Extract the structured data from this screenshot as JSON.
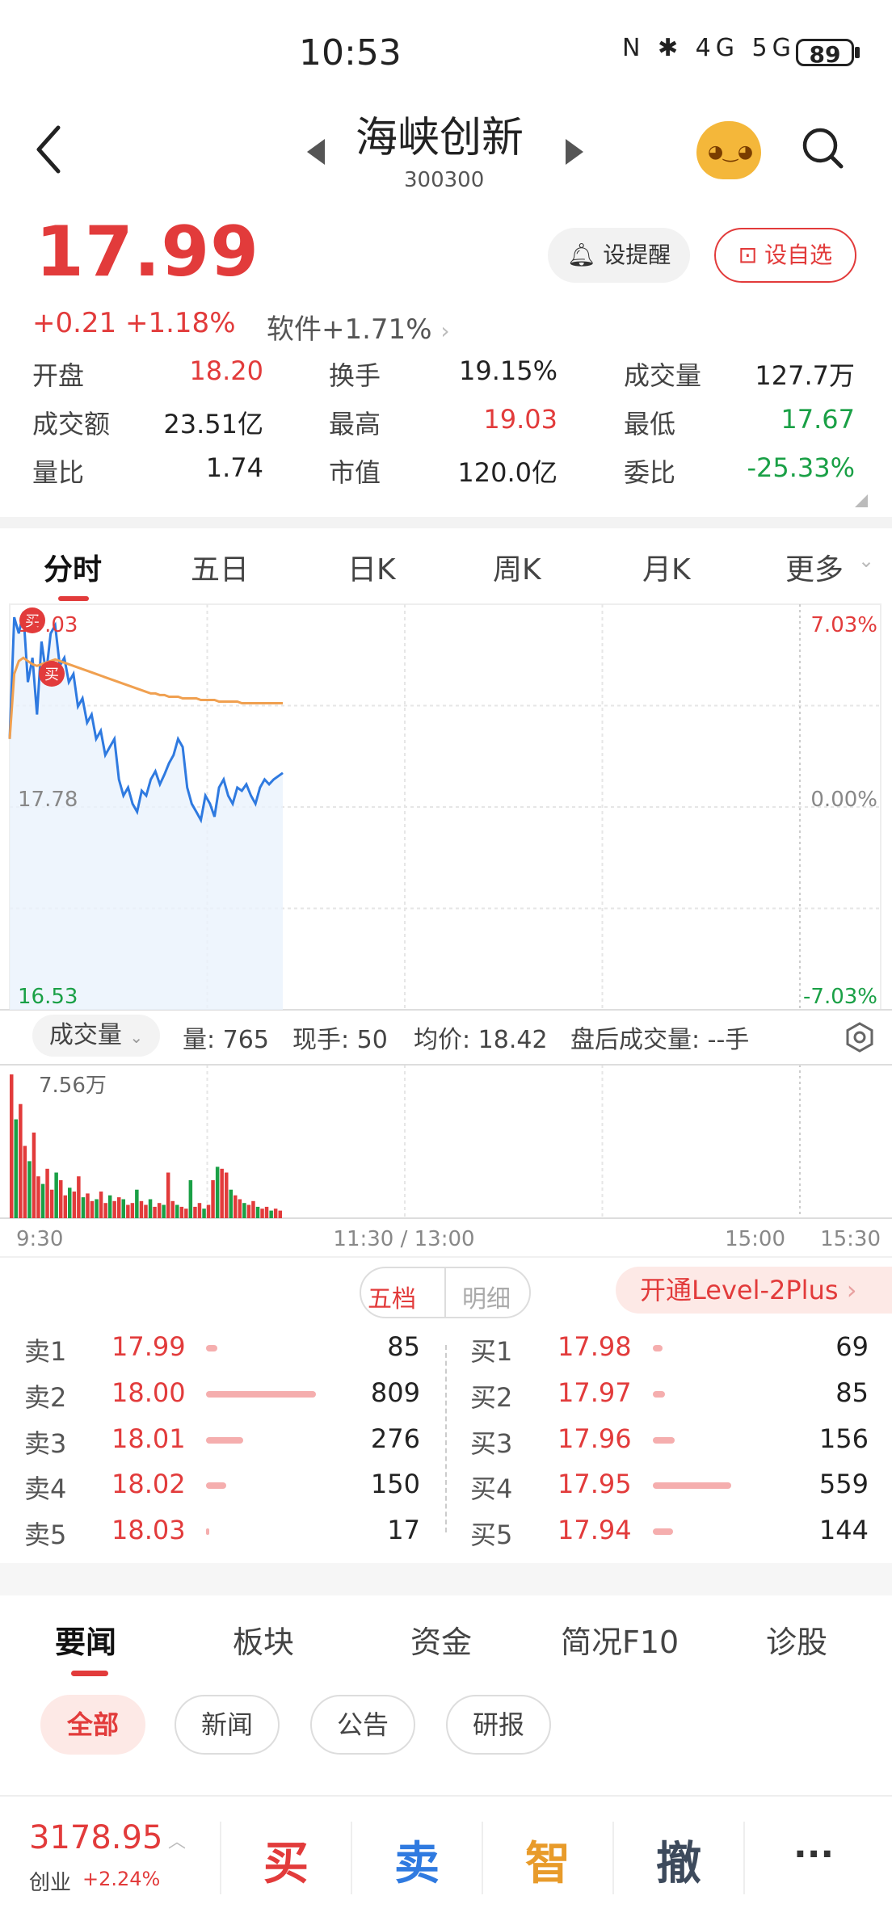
{
  "status_bar": {
    "time": "10:53",
    "icons": "N ✱ 4G 5G",
    "battery": "89"
  },
  "header": {
    "title": "海峡创新",
    "code": "300300"
  },
  "quote": {
    "price": "17.99",
    "change": "+0.21",
    "change_pct": "+1.18%",
    "sector": "软件+1.71%",
    "remind_label": "设提醒",
    "watch_label": "设自选",
    "stats": [
      {
        "label": "开盘",
        "value": "18.20",
        "color": "#e23b3b"
      },
      {
        "label": "换手",
        "value": "19.15%",
        "color": "#222222"
      },
      {
        "label": "成交量",
        "value": "127.7万",
        "color": "#222222"
      },
      {
        "label": "成交额",
        "value": "23.51亿",
        "color": "#222222"
      },
      {
        "label": "最高",
        "value": "19.03",
        "color": "#e23b3b"
      },
      {
        "label": "最低",
        "value": "17.67",
        "color": "#1aa046"
      },
      {
        "label": "量比",
        "value": "1.74",
        "color": "#222222"
      },
      {
        "label": "市值",
        "value": "120.0亿",
        "color": "#222222"
      },
      {
        "label": "委比",
        "value": "-25.33%",
        "color": "#1aa046"
      }
    ]
  },
  "chart_tabs": [
    "分时",
    "五日",
    "日K",
    "周K",
    "月K",
    "更多"
  ],
  "chart_data": {
    "type": "line",
    "ylim": [
      16.53,
      19.03
    ],
    "y_tick_labels": [
      "19.03",
      "17.78",
      "16.53"
    ],
    "right_tick_labels": [
      "7.03%",
      "0.00%",
      "-7.03%"
    ],
    "x_tick_labels": [
      "9:30",
      "11:30 / 13:00",
      "15:00",
      "15:30"
    ],
    "volume_max_label": "7.56万",
    "markers": [
      "买",
      "买"
    ],
    "series": [
      {
        "values": [
          18.2,
          18.95,
          18.85,
          18.98,
          18.55,
          18.7,
          18.35,
          18.8,
          18.6,
          18.85,
          18.9,
          18.65,
          18.7,
          18.55,
          18.6,
          18.4,
          18.45,
          18.3,
          18.35,
          18.2,
          18.25,
          18.1,
          18.15,
          18.2,
          17.95,
          17.85,
          17.9,
          17.8,
          17.75,
          17.88,
          17.85,
          17.95,
          18.0,
          17.92,
          17.98,
          18.05,
          18.1,
          18.2,
          18.15,
          17.9,
          17.8,
          17.75,
          17.7,
          17.85,
          17.8,
          17.72,
          17.9,
          17.95,
          17.85,
          17.8,
          17.9,
          17.88,
          17.92,
          17.85,
          17.8,
          17.9,
          17.95,
          17.92,
          17.95,
          17.97,
          17.99
        ]
      },
      {
        "values": [
          18.2,
          18.6,
          18.68,
          18.7,
          18.68,
          18.66,
          18.65,
          18.66,
          18.67,
          18.68,
          18.69,
          18.68,
          18.67,
          18.66,
          18.65,
          18.64,
          18.63,
          18.62,
          18.61,
          18.6,
          18.59,
          18.58,
          18.57,
          18.56,
          18.55,
          18.54,
          18.53,
          18.52,
          18.51,
          18.5,
          18.49,
          18.48,
          18.48,
          18.47,
          18.47,
          18.46,
          18.46,
          18.46,
          18.45,
          18.45,
          18.45,
          18.45,
          18.44,
          18.44,
          18.44,
          18.44,
          18.43,
          18.43,
          18.43,
          18.43,
          18.43,
          18.42,
          18.42,
          18.42,
          18.42,
          18.42,
          18.42,
          18.42,
          18.42,
          18.42,
          18.42
        ]
      }
    ],
    "volume": [
      75600,
      52000,
      60000,
      38000,
      30000,
      45000,
      22000,
      18000,
      26000,
      15000,
      24000,
      20000,
      12000,
      16000,
      14000,
      22000,
      11000,
      13000,
      9000,
      10000,
      14000,
      8000,
      12000,
      9000,
      11000,
      10000,
      7000,
      8000,
      15000,
      9000,
      7000,
      10000,
      6000,
      8000,
      7000,
      24000,
      9000,
      7000,
      6000,
      5000,
      20000,
      6000,
      8000,
      5000,
      7000,
      20000,
      27000,
      26000,
      24000,
      15000,
      12000,
      10000,
      8000,
      7000,
      9000,
      6000,
      5000,
      6000,
      4000,
      5000,
      4000
    ]
  },
  "volume_info": {
    "dropdown": "成交量",
    "items": [
      "量: 765",
      "现手: 50",
      "均价: 18.42",
      "盘后成交量: --手"
    ]
  },
  "order_book": {
    "seg_a": "五档",
    "seg_b": "明细",
    "level2": "开通Level-2Plus",
    "sell": [
      {
        "label": "卖1",
        "price": "17.99",
        "vol": "85"
      },
      {
        "label": "卖2",
        "price": "18.00",
        "vol": "809"
      },
      {
        "label": "卖3",
        "price": "18.01",
        "vol": "276"
      },
      {
        "label": "卖4",
        "price": "18.02",
        "vol": "150"
      },
      {
        "label": "卖5",
        "price": "18.03",
        "vol": "17"
      }
    ],
    "buy": [
      {
        "label": "买1",
        "price": "17.98",
        "vol": "69"
      },
      {
        "label": "买2",
        "price": "17.97",
        "vol": "85"
      },
      {
        "label": "买3",
        "price": "17.96",
        "vol": "156"
      },
      {
        "label": "买4",
        "price": "17.95",
        "vol": "559"
      },
      {
        "label": "买5",
        "price": "17.94",
        "vol": "144"
      }
    ]
  },
  "news_tabs": [
    "要闻",
    "板块",
    "资金",
    "简况F10",
    "诊股"
  ],
  "news_chips": [
    "全部",
    "新闻",
    "公告",
    "研报"
  ],
  "bottom": {
    "index_value": "3178.95",
    "index_name": "创业",
    "index_change": "+2.24%",
    "actions": [
      "买",
      "卖",
      "智",
      "撤"
    ],
    "more": "···",
    "action_colors": [
      "#e23b3b",
      "#2f7ae0",
      "#e89b2a",
      "#3d4a5c"
    ]
  }
}
